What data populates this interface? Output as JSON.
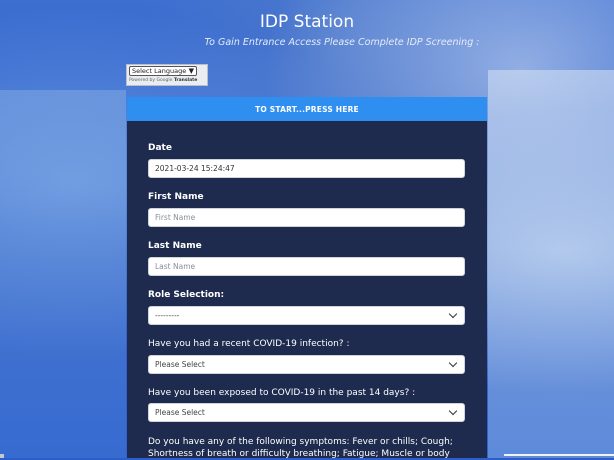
{
  "header": {
    "title": "IDP Station",
    "subtitle": "To Gain Entrance Access Please Complete IDP Screening :"
  },
  "translate": {
    "select_label": "Select Language",
    "powered_by": "Powered by",
    "google": "Google",
    "translate_word": "Translate"
  },
  "start_button": {
    "label": "TO START...PRESS HERE"
  },
  "form": {
    "date": {
      "label": "Date",
      "value": "2021-03-24 15:24:47"
    },
    "first_name": {
      "label": "First Name",
      "placeholder": "First Name"
    },
    "last_name": {
      "label": "Last Name",
      "placeholder": "Last Name"
    },
    "role": {
      "label": "Role Selection:",
      "selected": "---------"
    },
    "covid_infection": {
      "label": "Have you had a recent COVID-19 infection? :",
      "selected": "Please Select"
    },
    "covid_exposure": {
      "label": "Have you been exposed to COVID-19 in the past 14 days? :",
      "selected": "Please Select"
    },
    "symptoms": {
      "label": "Do you have any of the following symptoms: Fever or chills; Cough; Shortness of breath or difficulty breathing; Fatigue; Muscle or body"
    }
  }
}
